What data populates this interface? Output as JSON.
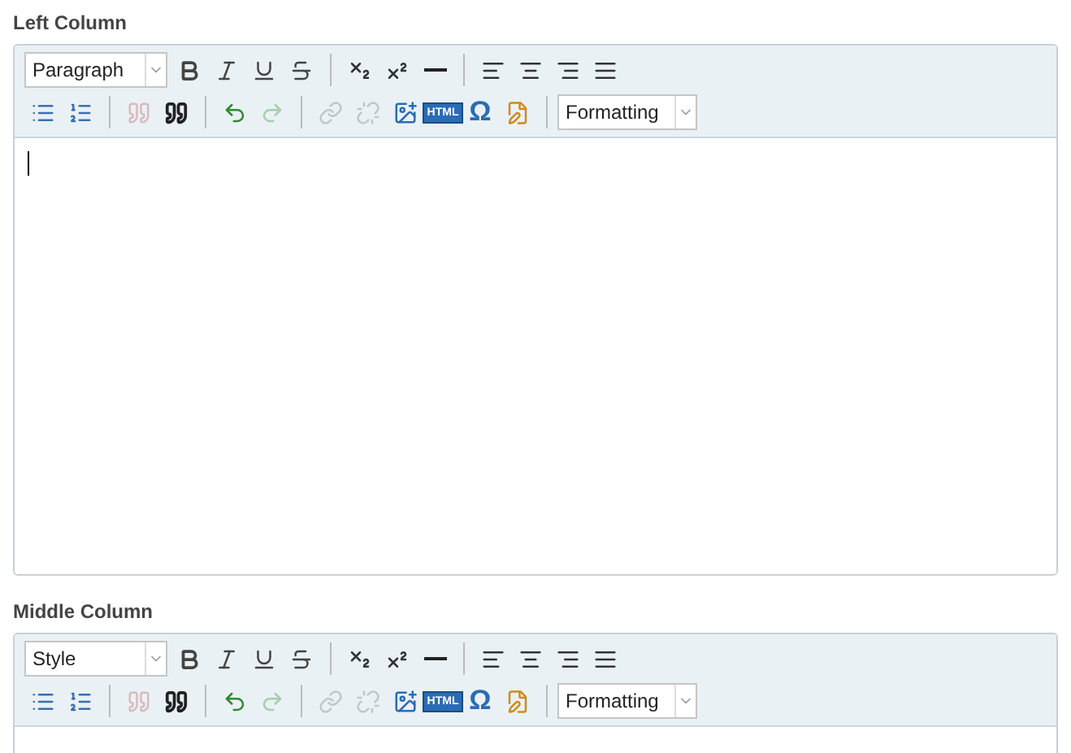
{
  "editors": [
    {
      "label": "Left Column",
      "style_select": {
        "value": "Paragraph"
      },
      "format_select": {
        "value": "Formatting"
      },
      "cursor": true,
      "tools": [
        [
          {
            "kind": "bold",
            "disabled": false
          },
          {
            "kind": "italic",
            "disabled": false
          },
          {
            "kind": "underline",
            "disabled": false
          },
          {
            "kind": "strikethrough",
            "disabled": false
          },
          {
            "kind": "separator"
          },
          {
            "kind": "subscript",
            "disabled": false
          },
          {
            "kind": "superscript",
            "disabled": false
          },
          {
            "kind": "rule",
            "disabled": false
          },
          {
            "kind": "separator"
          },
          {
            "kind": "align-left",
            "disabled": false
          },
          {
            "kind": "align-center",
            "disabled": false
          },
          {
            "kind": "align-right",
            "disabled": false
          },
          {
            "kind": "justify",
            "disabled": false
          }
        ],
        [
          {
            "kind": "bullets",
            "disabled": false
          },
          {
            "kind": "numbers",
            "disabled": false
          },
          {
            "kind": "separator"
          },
          {
            "kind": "unquote",
            "disabled": true
          },
          {
            "kind": "quote",
            "disabled": false
          },
          {
            "kind": "separator"
          },
          {
            "kind": "undo",
            "disabled": false
          },
          {
            "kind": "redo",
            "disabled": true
          },
          {
            "kind": "separator"
          },
          {
            "kind": "link",
            "disabled": true
          },
          {
            "kind": "unlink",
            "disabled": true
          },
          {
            "kind": "image",
            "disabled": false
          },
          {
            "kind": "html",
            "label": "HTML",
            "disabled": false
          },
          {
            "kind": "char",
            "label": "Ω",
            "disabled": false
          },
          {
            "kind": "template",
            "disabled": false
          },
          {
            "kind": "separator"
          }
        ]
      ]
    },
    {
      "label": "Middle Column",
      "style_select": {
        "value": "Style"
      },
      "format_select": {
        "value": "Formatting"
      },
      "cursor": false,
      "tools": [
        [
          {
            "kind": "bold",
            "disabled": false
          },
          {
            "kind": "italic",
            "disabled": false
          },
          {
            "kind": "underline",
            "disabled": false
          },
          {
            "kind": "strikethrough",
            "disabled": false
          },
          {
            "kind": "separator"
          },
          {
            "kind": "subscript",
            "disabled": false
          },
          {
            "kind": "superscript",
            "disabled": false
          },
          {
            "kind": "rule",
            "disabled": false
          },
          {
            "kind": "separator"
          },
          {
            "kind": "align-left",
            "disabled": false
          },
          {
            "kind": "align-center",
            "disabled": false
          },
          {
            "kind": "align-right",
            "disabled": false
          },
          {
            "kind": "justify",
            "disabled": false
          }
        ],
        [
          {
            "kind": "bullets",
            "disabled": false
          },
          {
            "kind": "numbers",
            "disabled": false
          },
          {
            "kind": "separator"
          },
          {
            "kind": "unquote",
            "disabled": true
          },
          {
            "kind": "quote",
            "disabled": false
          },
          {
            "kind": "separator"
          },
          {
            "kind": "undo",
            "disabled": false
          },
          {
            "kind": "redo",
            "disabled": true
          },
          {
            "kind": "separator"
          },
          {
            "kind": "link",
            "disabled": true
          },
          {
            "kind": "unlink",
            "disabled": true
          },
          {
            "kind": "image",
            "disabled": false
          },
          {
            "kind": "html",
            "label": "HTML",
            "disabled": false
          },
          {
            "kind": "char",
            "label": "Ω",
            "disabled": false
          },
          {
            "kind": "template",
            "disabled": false
          },
          {
            "kind": "separator"
          }
        ]
      ]
    }
  ]
}
